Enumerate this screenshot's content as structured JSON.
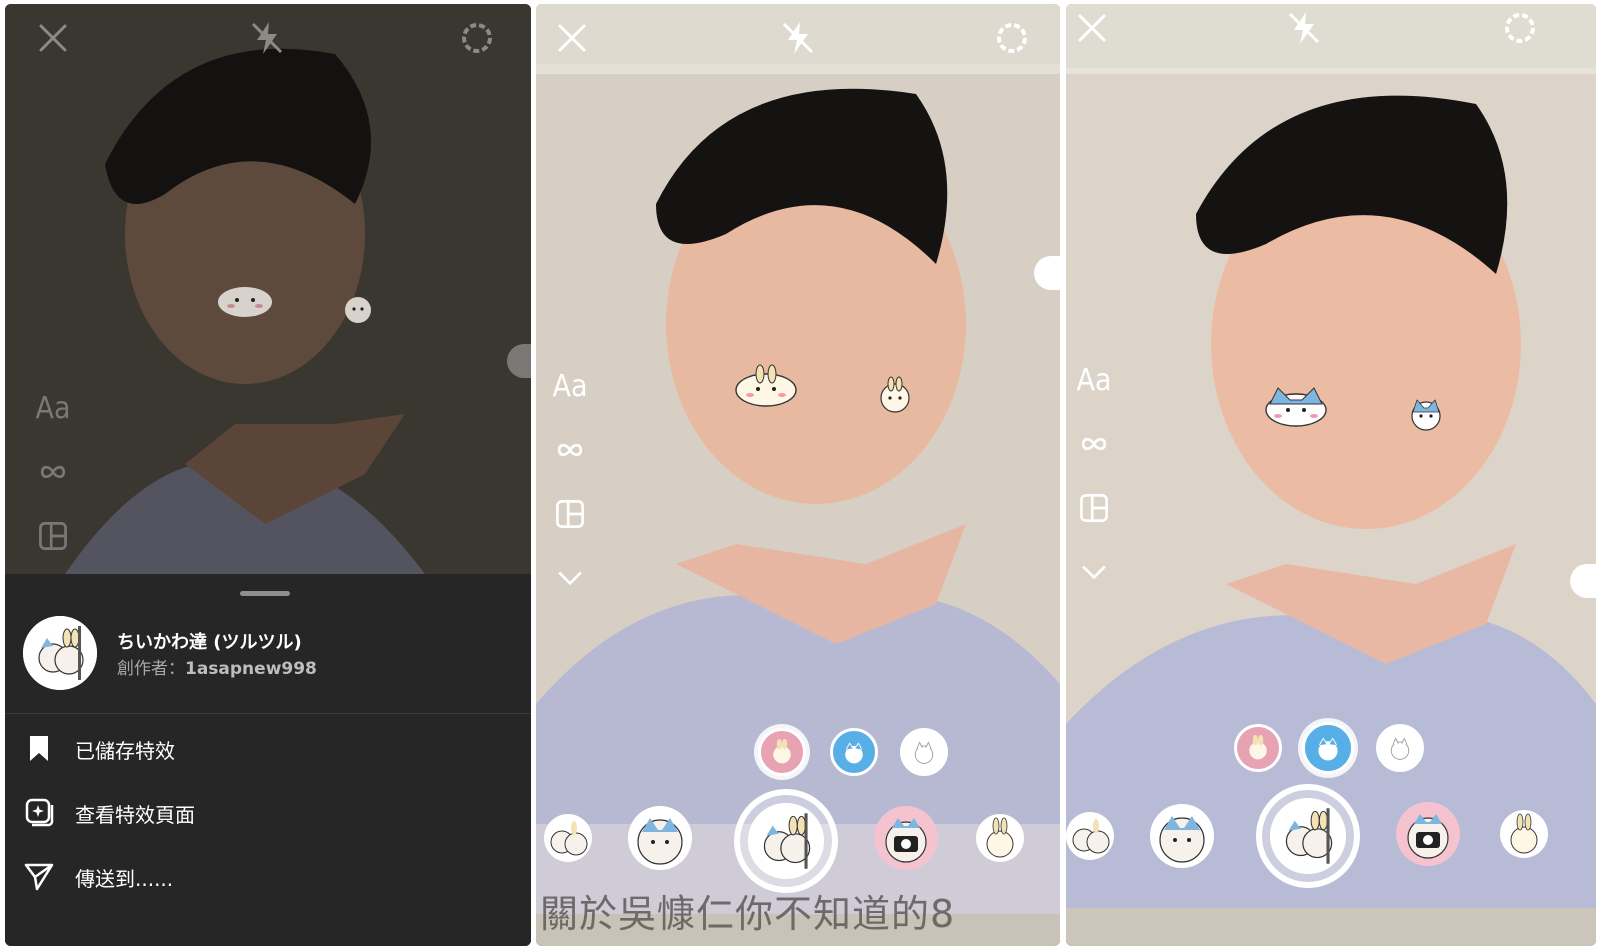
{
  "panel1": {
    "tools": {
      "text_tool": "Aa"
    },
    "sheet": {
      "effect_name": "ちいかわ達 (ツルツル)",
      "creator_prefix": "創作者：",
      "creator_handle": "1asapnew998",
      "menu": [
        {
          "label": "已儲存特效",
          "icon": "bookmark-icon"
        },
        {
          "label": "查看特效頁面",
          "icon": "effect-page-icon"
        },
        {
          "label": "傳送到......",
          "icon": "send-icon"
        }
      ]
    }
  },
  "panel2": {
    "tools": {
      "text_tool": "Aa"
    },
    "caption": "關於吳慷仁你不知道的8"
  },
  "panel3": {
    "tools": {
      "text_tool": "Aa"
    }
  },
  "icons": {
    "close": "close-icon",
    "flash": "flash-off-icon",
    "settings": "settings-icon",
    "boomerang": "infinity-icon",
    "layout": "layout-icon",
    "more": "chevron-down-icon"
  },
  "colors": {
    "sheet_bg": "#262626",
    "variant_pink": "#e7a2b4",
    "variant_blue": "#58aee6",
    "variant_white": "#ffffff"
  }
}
